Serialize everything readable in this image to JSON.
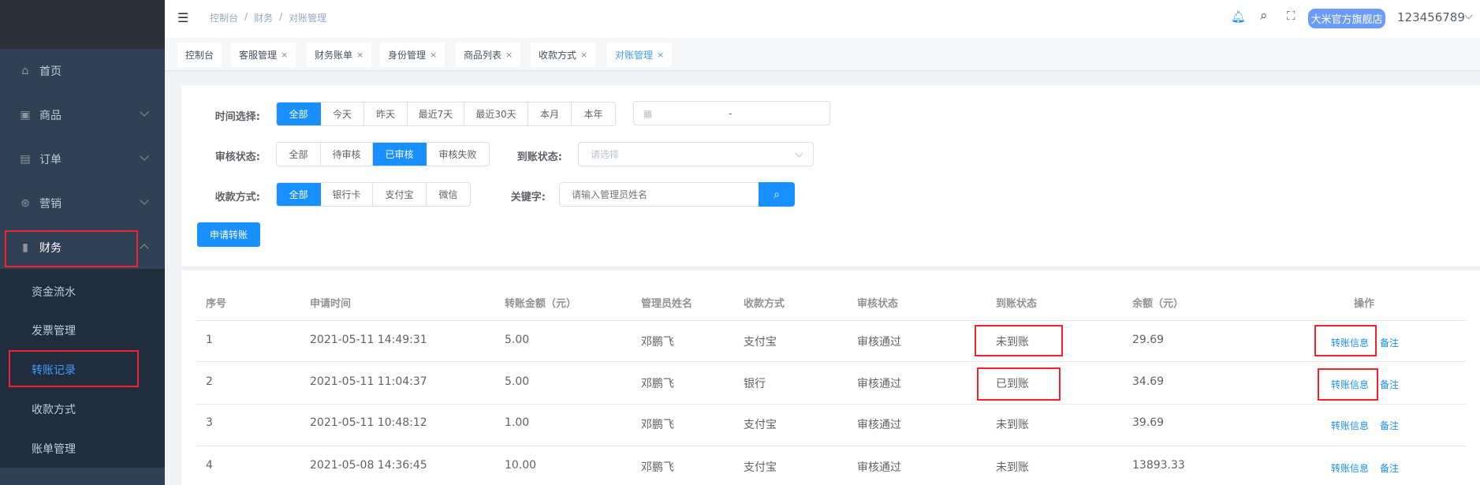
{
  "sidebar": {
    "menu": [
      {
        "label": "首页",
        "icon": "home-icon"
      },
      {
        "label": "商品",
        "icon": "shopping-bag-icon"
      },
      {
        "label": "订单",
        "icon": "clipboard-icon"
      },
      {
        "label": "营销",
        "icon": "wheel-icon"
      },
      {
        "label": "财务",
        "icon": "bar-chart-icon"
      }
    ],
    "submenu": [
      "资金流水",
      "发票管理",
      "转账记录",
      "收款方式",
      "账单管理"
    ]
  },
  "header": {
    "breadcrumb": [
      "控制台",
      "财务",
      "对账管理"
    ],
    "separator": "/",
    "store_badge": "大米官方旗舰店",
    "username": "123456789"
  },
  "tags": [
    {
      "label": "控制台"
    },
    {
      "label": "客服管理",
      "close": "×"
    },
    {
      "label": "财务账单",
      "close": "×"
    },
    {
      "label": "身份管理",
      "close": "×"
    },
    {
      "label": "商品列表",
      "close": "×"
    },
    {
      "label": "收款方式",
      "close": "×"
    },
    {
      "label": "对账管理",
      "close": "×"
    }
  ],
  "filters": {
    "time": {
      "label": "时间选择:",
      "options": [
        "全部",
        "今天",
        "昨天",
        "最近7天",
        "最近30天",
        "本月",
        "本年"
      ],
      "selected": "全部",
      "range_sep": "-"
    },
    "audit": {
      "label": "审核状态:",
      "options": [
        "全部",
        "待审核",
        "已审核",
        "审核失败"
      ],
      "selected": "已审核"
    },
    "arrival": {
      "label": "到账状态:",
      "placeholder": "请选择"
    },
    "payment": {
      "label": "收款方式:",
      "options": [
        "全部",
        "银行卡",
        "支付宝",
        "微信"
      ],
      "selected": "全部"
    },
    "keyword": {
      "label": "关键字:",
      "placeholder": "请输入管理员姓名"
    },
    "apply_button": "申请转账"
  },
  "table": {
    "headers": [
      "序号",
      "申请时间",
      "转账金额（元）",
      "管理员姓名",
      "收款方式",
      "审核状态",
      "到账状态",
      "余额（元）",
      "操作"
    ],
    "rows": [
      {
        "no": "1",
        "time": "2021-05-11 14:49:31",
        "amount": "5.00",
        "admin": "邓鹏飞",
        "method": "支付宝",
        "audit": "审核通过",
        "arrival": "未到账",
        "balance": "29.69",
        "info": "转账信息",
        "note": "备注"
      },
      {
        "no": "2",
        "time": "2021-05-11 11:04:37",
        "amount": "5.00",
        "admin": "邓鹏飞",
        "method": "银行",
        "audit": "审核通过",
        "arrival": "已到账",
        "balance": "34.69",
        "info": "转账信息",
        "note": "备注"
      },
      {
        "no": "3",
        "time": "2021-05-11 10:48:12",
        "amount": "1.00",
        "admin": "邓鹏飞",
        "method": "支付宝",
        "audit": "审核通过",
        "arrival": "未到账",
        "balance": "39.69",
        "info": "转账信息",
        "note": "备注"
      },
      {
        "no": "4",
        "time": "2021-05-08 14:36:45",
        "amount": "10.00",
        "admin": "邓鹏飞",
        "method": "支付宝",
        "audit": "审核通过",
        "arrival": "未到账",
        "balance": "13893.33",
        "info": "转账信息",
        "note": "备注"
      }
    ]
  },
  "colors": {
    "primary": "#1890ff",
    "sidebar": "#304156",
    "submenu": "#1f2d3d",
    "highlight": "#f5222d"
  }
}
